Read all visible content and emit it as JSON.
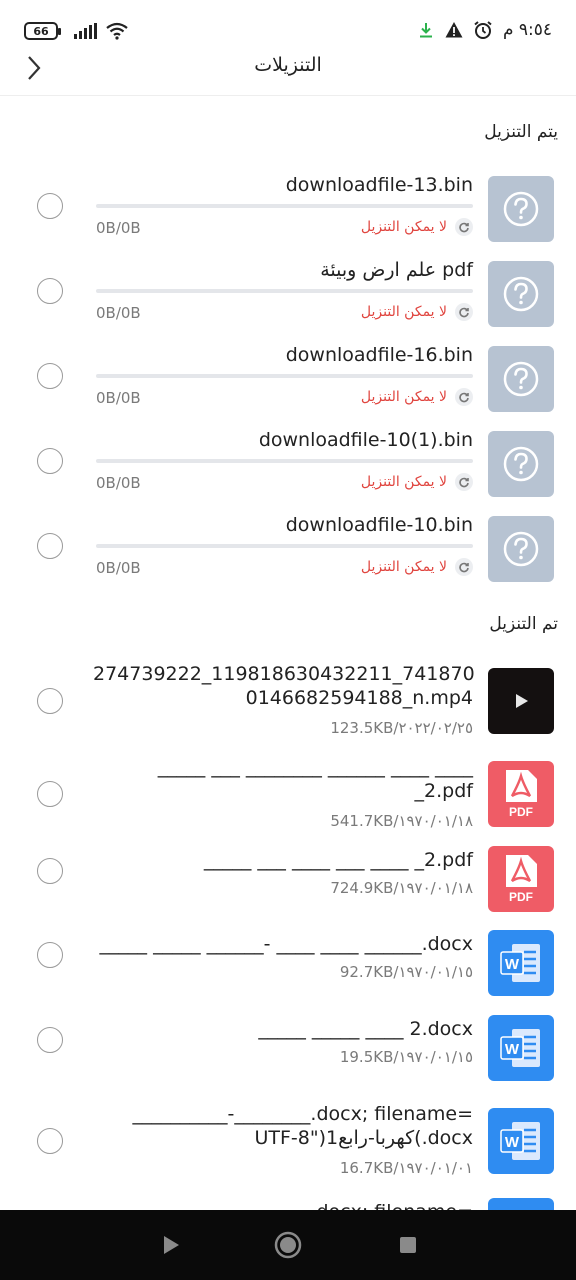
{
  "status_bar": {
    "battery": "66",
    "time": "٩:٥٤ م"
  },
  "header": {
    "title": "التنزيلات"
  },
  "sections": {
    "downloading": "يتم التنزيل",
    "downloaded": "تم التنزيل"
  },
  "downloading_items": [
    {
      "name": "downloadfile-13.bin",
      "size": "0B/0B",
      "status": "لا يمكن التنزيل",
      "progress": 0
    },
    {
      "name": "علم ارض وبيئة pdf",
      "size": "0B/0B",
      "status": "لا يمكن التنزيل",
      "progress": 0
    },
    {
      "name": "downloadfile-16.bin",
      "size": "0B/0B",
      "status": "لا يمكن التنزيل",
      "progress": 0
    },
    {
      "name": "downloadfile-10(1).bin",
      "size": "0B/0B",
      "status": "لا يمكن التنزيل",
      "progress": 0
    },
    {
      "name": "downloadfile-10.bin",
      "size": "0B/0B",
      "status": "لا يمكن التنزيل",
      "progress": 0
    }
  ],
  "downloaded_items": [
    {
      "line1": "274739222_119818630432211_741870",
      "line2": "0146682594188_n.mp4",
      "meta": "123.5KB/٢٠٢٢/٠٢/٢٥",
      "type": "video"
    },
    {
      "line1": "_____ ___ ________ ______ ____ ____",
      "line2": "_2.pdf",
      "meta": "541.7KB/١٩٧٠/٠١/١٨",
      "type": "pdf",
      "badge": "PDF"
    },
    {
      "line1": "_____ ___ ____ ___ ____ _2.pdf",
      "line2": "",
      "meta": "724.9KB/١٩٧٠/٠١/١٨",
      "type": "pdf",
      "badge": "PDF"
    },
    {
      "line1": "_____ _____ ______- ____ ____ ______.docx",
      "line2": "",
      "meta": "92.7KB/١٩٧٠/٠١/١٥",
      "type": "word",
      "badge": "W"
    },
    {
      "line1": "_____ _____ ____ 2.docx",
      "line2": "",
      "meta": "19.5KB/١٩٧٠/٠١/١٥",
      "type": "word",
      "badge": "W"
    },
    {
      "line1": "__________-________.docx; filename=",
      "line2": "UTF-8\")1كهربا-رابع(.docx",
      "meta": "16.7KB/١٩٧٠/٠١/٠١",
      "type": "word",
      "badge": "W"
    },
    {
      "line1": "docx; filename=",
      "line2": "",
      "meta": "",
      "type": "word",
      "badge": ""
    }
  ],
  "colors": {
    "error": "#e0453f",
    "unknown_thumb": "#b7c3d2",
    "pdf_thumb": "#ef5c66",
    "word_thumb": "#2f8cf1",
    "download_icon": "#2bb24c"
  },
  "icons": [
    "back-chevron-icon",
    "question-icon",
    "retry-icon",
    "play-icon",
    "pdf-icon",
    "word-icon",
    "download-arrow-icon",
    "warning-icon",
    "alarm-icon",
    "wifi-icon",
    "signal-icon",
    "battery-icon"
  ]
}
